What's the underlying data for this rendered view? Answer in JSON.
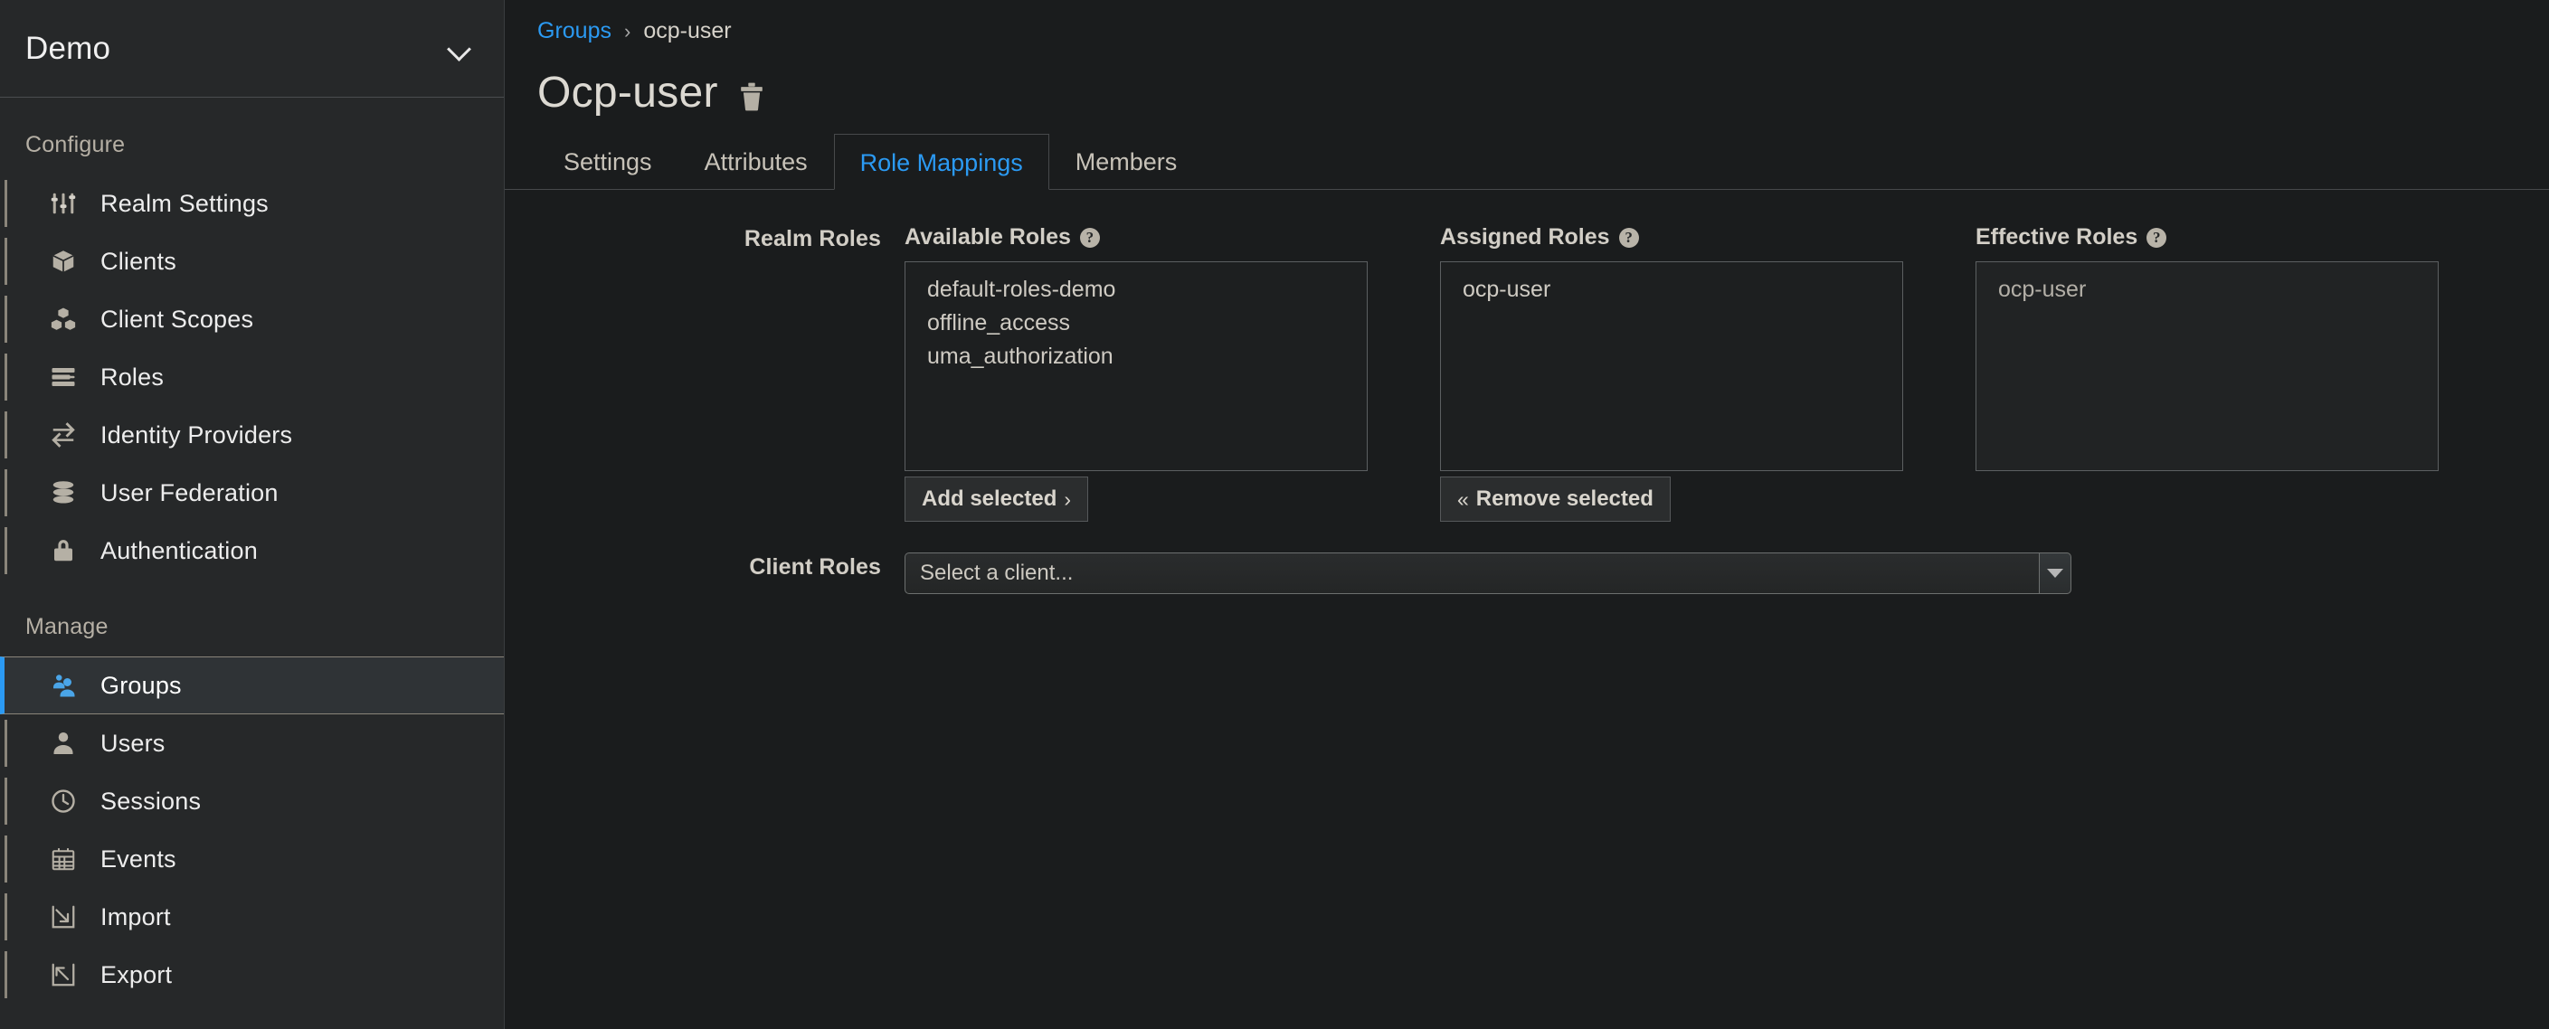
{
  "sidebar": {
    "realm": {
      "name": "Demo",
      "chevron_icon": "chevron-down-icon"
    },
    "sections": [
      {
        "title": "Configure",
        "items": [
          {
            "label": "Realm Settings",
            "icon": "sliders-icon",
            "active": false
          },
          {
            "label": "Clients",
            "icon": "cube-icon",
            "active": false
          },
          {
            "label": "Client Scopes",
            "icon": "cubes-icon",
            "active": false
          },
          {
            "label": "Roles",
            "icon": "list-bars-icon",
            "active": false
          },
          {
            "label": "Identity Providers",
            "icon": "exchange-arrows-icon",
            "active": false
          },
          {
            "label": "User Federation",
            "icon": "database-icon",
            "active": false
          },
          {
            "label": "Authentication",
            "icon": "lock-icon",
            "active": false
          }
        ]
      },
      {
        "title": "Manage",
        "items": [
          {
            "label": "Groups",
            "icon": "users-group-icon",
            "active": true
          },
          {
            "label": "Users",
            "icon": "user-icon",
            "active": false
          },
          {
            "label": "Sessions",
            "icon": "clock-icon",
            "active": false
          },
          {
            "label": "Events",
            "icon": "calendar-icon",
            "active": false
          },
          {
            "label": "Import",
            "icon": "import-arrow-icon",
            "active": false
          },
          {
            "label": "Export",
            "icon": "export-arrow-icon",
            "active": false
          }
        ]
      }
    ]
  },
  "breadcrumb": {
    "root": "Groups",
    "separator": "›",
    "current": "ocp-user"
  },
  "page": {
    "title": "Ocp-user",
    "delete_icon": "trash-icon"
  },
  "tabs": [
    {
      "label": "Settings",
      "active": false
    },
    {
      "label": "Attributes",
      "active": false
    },
    {
      "label": "Role Mappings",
      "active": true
    },
    {
      "label": "Members",
      "active": false
    }
  ],
  "role_mappings": {
    "realm_roles_label": "Realm Roles",
    "available": {
      "title": "Available Roles",
      "help_icon": "question-circle-icon",
      "options": [
        "default-roles-demo",
        "offline_access",
        "uma_authorization"
      ],
      "button": "Add selected",
      "button_arrow": "›"
    },
    "assigned": {
      "title": "Assigned Roles",
      "help_icon": "question-circle-icon",
      "options": [
        "ocp-user"
      ],
      "button": "Remove selected",
      "button_arrow": "«"
    },
    "effective": {
      "title": "Effective Roles",
      "help_icon": "question-circle-icon",
      "options": [
        "ocp-user"
      ]
    },
    "client_roles_label": "Client Roles",
    "client_select": {
      "value": "Select a client...",
      "caret_icon": "caret-down-icon"
    }
  },
  "colors": {
    "accent_blue": "#2b9af3",
    "sidebar_bg": "#262829",
    "main_bg": "#1a1c1d",
    "text": "#d2cec6"
  }
}
